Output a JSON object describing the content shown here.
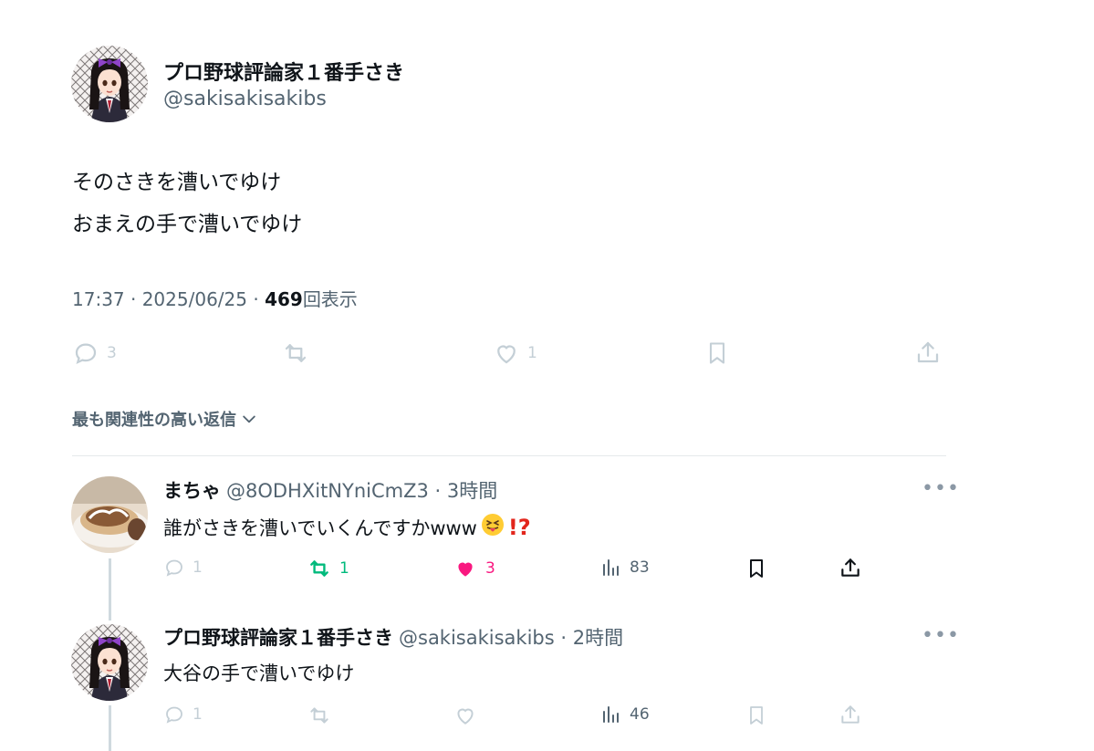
{
  "main_tweet": {
    "author_name": "プロ野球評論家１番手さき",
    "author_handle": "@sakisakisakibs",
    "text_line1": "そのさきを漕いでゆけ",
    "text_line2": "おまえの手で漕いでゆけ",
    "time": "17:37 · 2025/06/25 · ",
    "views_count": "469",
    "views_label": "回表示",
    "actions": {
      "reply_count": "3",
      "retweet_count": "",
      "like_count": "1"
    }
  },
  "sort_label": "最も関連性の高い返信",
  "replies": [
    {
      "author_name": "まちゃ",
      "meta": "@8ODHXitNYniCmZ3 · 3時間",
      "text": "誰がさきを漕いでいくんですかwww",
      "emojis": [
        "😝",
        "⁉️"
      ],
      "reply_count": "1",
      "retweet_count": "1",
      "like_count": "3",
      "views": "83"
    },
    {
      "author_name": "プロ野球評論家１番手さき",
      "meta": "@sakisakisakibs · 2時間",
      "text": "大谷の手で漕いでゆけ",
      "reply_count": "1",
      "retweet_count": "",
      "like_count": "",
      "views": "46"
    }
  ],
  "colors": {
    "text": "#0f1419",
    "secondary": "#536471",
    "faded_icon": "#c4cfd6",
    "retweet_green": "#00ba7c",
    "like_pink": "#f91880",
    "avatar_bow": "#8e44c8"
  },
  "icons": [
    "reply-icon",
    "retweet-icon",
    "like-icon",
    "views-icon",
    "bookmark-icon",
    "share-icon",
    "chevron-down-icon",
    "more-icon"
  ]
}
